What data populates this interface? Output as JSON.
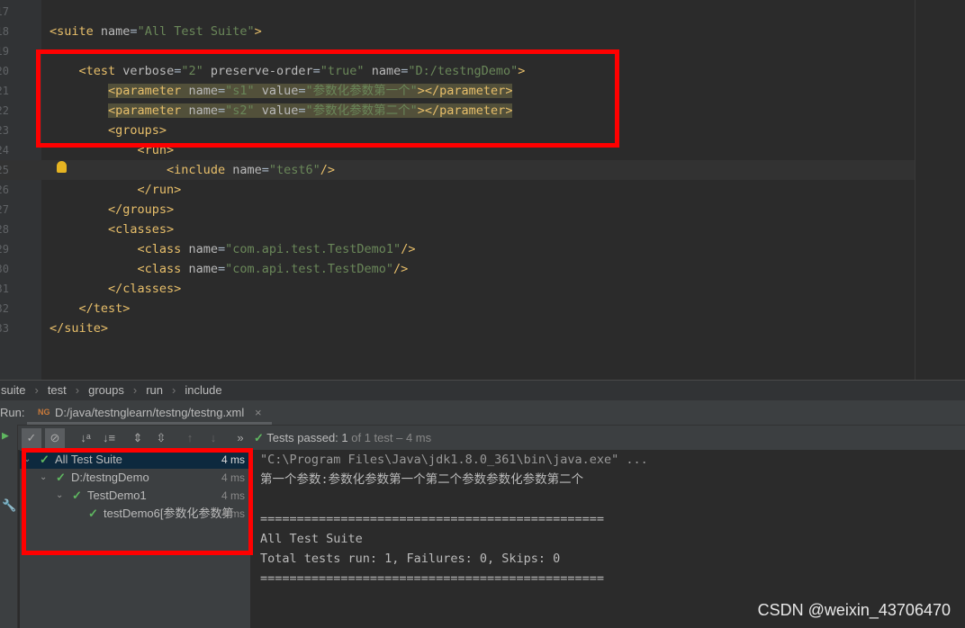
{
  "editor": {
    "lines": [
      {
        "n": "17",
        "tokens": []
      },
      {
        "n": "18",
        "tokens": [
          [
            "tag",
            "<suite "
          ],
          [
            "attr",
            "name"
          ],
          [
            "txt",
            "="
          ],
          [
            "val",
            "\"All Test Suite\""
          ],
          [
            "tag",
            ">"
          ]
        ]
      },
      {
        "n": "19",
        "tokens": []
      },
      {
        "n": "20",
        "tokens": [
          [
            "txt",
            "    "
          ],
          [
            "tag",
            "<test "
          ],
          [
            "attr",
            "verbose"
          ],
          [
            "txt",
            "="
          ],
          [
            "val",
            "\"2\" "
          ],
          [
            "attr",
            "preserve-order"
          ],
          [
            "txt",
            "="
          ],
          [
            "val",
            "\"true\" "
          ],
          [
            "attr",
            "name"
          ],
          [
            "txt",
            "="
          ],
          [
            "val",
            "\"D:/testngDemo\""
          ],
          [
            "tag",
            ">"
          ]
        ]
      },
      {
        "n": "21",
        "hl": true,
        "tokens": [
          [
            "txt",
            "        "
          ],
          [
            "tag",
            "<parameter "
          ],
          [
            "attr",
            "name"
          ],
          [
            "txt",
            "="
          ],
          [
            "val",
            "\"s1\" "
          ],
          [
            "attr",
            "value"
          ],
          [
            "txt",
            "="
          ],
          [
            "val",
            "\"参数化参数第一个\""
          ],
          [
            "tag",
            "></parameter>"
          ]
        ]
      },
      {
        "n": "22",
        "hl": true,
        "tokens": [
          [
            "txt",
            "        "
          ],
          [
            "tag",
            "<parameter "
          ],
          [
            "attr",
            "name"
          ],
          [
            "txt",
            "="
          ],
          [
            "val",
            "\"s2\" "
          ],
          [
            "attr",
            "value"
          ],
          [
            "txt",
            "="
          ],
          [
            "val",
            "\"参数化参数第二个\""
          ],
          [
            "tag",
            "></parameter>"
          ]
        ]
      },
      {
        "n": "23",
        "tokens": [
          [
            "txt",
            "        "
          ],
          [
            "tag",
            "<groups>"
          ]
        ]
      },
      {
        "n": "24",
        "tokens": [
          [
            "txt",
            "            "
          ],
          [
            "tag",
            "<run>"
          ]
        ]
      },
      {
        "n": "25",
        "cur": true,
        "tokens": [
          [
            "txt",
            "                "
          ],
          [
            "tag",
            "<include "
          ],
          [
            "attr",
            "name"
          ],
          [
            "txt",
            "="
          ],
          [
            "val",
            "\"test6\""
          ],
          [
            "tag",
            "/>"
          ]
        ]
      },
      {
        "n": "26",
        "tokens": [
          [
            "txt",
            "            "
          ],
          [
            "tag",
            "</run>"
          ]
        ]
      },
      {
        "n": "27",
        "tokens": [
          [
            "txt",
            "        "
          ],
          [
            "tag",
            "</groups>"
          ]
        ]
      },
      {
        "n": "28",
        "tokens": [
          [
            "txt",
            "        "
          ],
          [
            "tag",
            "<classes>"
          ]
        ]
      },
      {
        "n": "29",
        "tokens": [
          [
            "txt",
            "            "
          ],
          [
            "tag",
            "<class "
          ],
          [
            "attr",
            "name"
          ],
          [
            "txt",
            "="
          ],
          [
            "val",
            "\"com.api.test.TestDemo1\""
          ],
          [
            "tag",
            "/>"
          ]
        ]
      },
      {
        "n": "30",
        "tokens": [
          [
            "txt",
            "            "
          ],
          [
            "tag",
            "<class "
          ],
          [
            "attr",
            "name"
          ],
          [
            "txt",
            "="
          ],
          [
            "val",
            "\"com.api.test.TestDemo\""
          ],
          [
            "tag",
            "/>"
          ]
        ]
      },
      {
        "n": "31",
        "tokens": [
          [
            "txt",
            "        "
          ],
          [
            "tag",
            "</classes>"
          ]
        ]
      },
      {
        "n": "32",
        "tokens": [
          [
            "txt",
            "    "
          ],
          [
            "tag",
            "</test>"
          ]
        ]
      },
      {
        "n": "33",
        "tokens": [
          [
            "tag",
            "</suite>"
          ]
        ]
      }
    ]
  },
  "breadcrumb": [
    "suite",
    "test",
    "groups",
    "run",
    "include"
  ],
  "run": {
    "label": "Run:",
    "tab": "D:/java/testnglearn/testng/testng.xml",
    "icon": "testng-icon"
  },
  "status": {
    "prefix": "Tests passed: ",
    "passed": "1",
    "rest": " of 1 test – 4 ms"
  },
  "tree": [
    {
      "label": "All Test Suite",
      "time": "4 ms",
      "depth": 0,
      "selected": true
    },
    {
      "label": "D:/testngDemo",
      "time": "4 ms",
      "depth": 1
    },
    {
      "label": "TestDemo1",
      "time": "4 ms",
      "depth": 2
    },
    {
      "label": "testDemo6[参数化参数第",
      "time": "4 ms",
      "depth": 3
    }
  ],
  "console": [
    "\"C:\\Program Files\\Java\\jdk1.8.0_361\\bin\\java.exe\" ...",
    "第一个参数:参数化参数第一个第二个参数参数化参数第二个",
    "",
    "===============================================",
    "All Test Suite",
    "Total tests run: 1, Failures: 0, Skips: 0",
    "==============================================="
  ],
  "watermark": "CSDN @weixin_43706470",
  "colors": {
    "highlight": "#ff0000",
    "pass": "#5fb760"
  }
}
